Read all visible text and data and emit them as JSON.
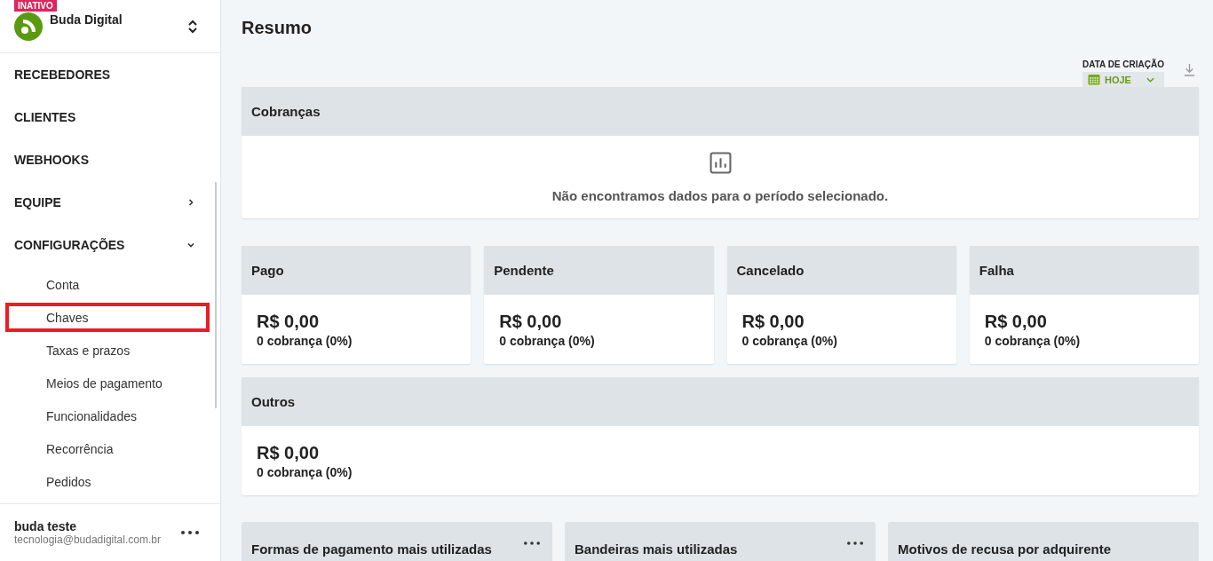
{
  "account": {
    "status": "INATIVO",
    "name": "Buda Digital"
  },
  "nav": [
    {
      "label": "RECEBEDORES",
      "kind": "link"
    },
    {
      "label": "CLIENTES",
      "kind": "link"
    },
    {
      "label": "WEBHOOKS",
      "kind": "link"
    },
    {
      "label": "EQUIPE",
      "kind": "group",
      "expanded": false
    },
    {
      "label": "CONFIGURAÇÕES",
      "kind": "group",
      "expanded": true,
      "children": [
        {
          "label": "Conta",
          "highlighted": false
        },
        {
          "label": "Chaves",
          "highlighted": true
        },
        {
          "label": "Taxas e prazos",
          "highlighted": false
        },
        {
          "label": "Meios de pagamento",
          "highlighted": false
        },
        {
          "label": "Funcionalidades",
          "highlighted": false
        },
        {
          "label": "Recorrência",
          "highlighted": false
        },
        {
          "label": "Pedidos",
          "highlighted": false
        }
      ]
    }
  ],
  "user": {
    "name": "buda teste",
    "email": "tecnologia@budadigital.com.br"
  },
  "page": {
    "title": "Resumo",
    "filter": {
      "label": "DATA DE CRIAÇÃO",
      "value": "HOJE"
    }
  },
  "charges": {
    "title": "Cobranças",
    "empty_message": "Não encontramos dados para o período selecionado."
  },
  "stats": [
    {
      "title": "Pago",
      "amount": "R$ 0,00",
      "count": "0 cobrança (0%)"
    },
    {
      "title": "Pendente",
      "amount": "R$ 0,00",
      "count": "0 cobrança (0%)"
    },
    {
      "title": "Cancelado",
      "amount": "R$ 0,00",
      "count": "0 cobrança (0%)"
    },
    {
      "title": "Falha",
      "amount": "R$ 0,00",
      "count": "0 cobrança (0%)"
    }
  ],
  "others": {
    "title": "Outros",
    "amount": "R$ 0,00",
    "count": "0 cobrança (0%)"
  },
  "bottom_cards": [
    {
      "title": "Formas de pagamento mais utilizadas"
    },
    {
      "title": "Bandeiras mais utilizadas"
    },
    {
      "title": "Motivos de recusa por adquirente"
    }
  ]
}
